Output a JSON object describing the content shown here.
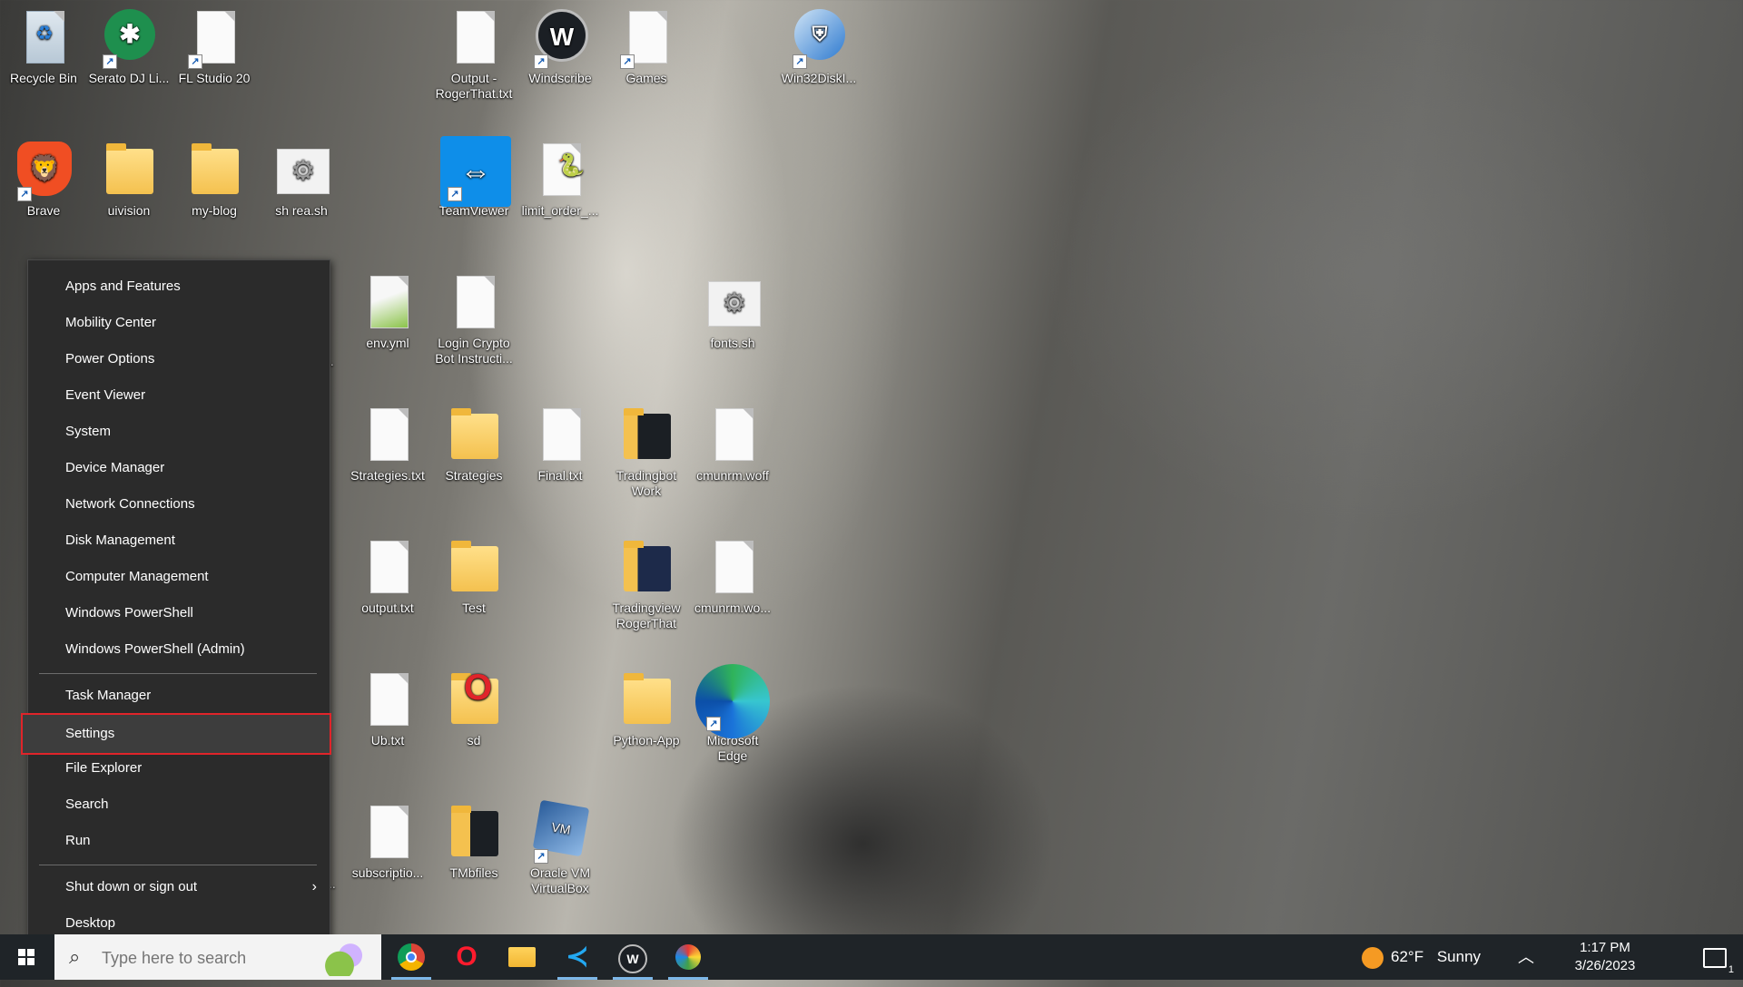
{
  "desktop": {
    "icons": [
      {
        "label": "Recycle Bin",
        "icon": "recycle-bin-icon"
      },
      {
        "label": "Serato DJ Li...",
        "icon": "serato-icon"
      },
      {
        "label": "FL Studio 20",
        "icon": "fl-studio-icon"
      },
      {
        "label": "Output - RogerThat.txt",
        "icon": "text-file-icon"
      },
      {
        "label": "Windscribe",
        "icon": "windscribe-icon"
      },
      {
        "label": "Games",
        "icon": "file-icon"
      },
      {
        "label": "Win32DiskI...",
        "icon": "win32-disk-imager-icon"
      },
      {
        "label": "Brave",
        "icon": "brave-icon"
      },
      {
        "label": "uivision",
        "icon": "folder-icon"
      },
      {
        "label": "my-blog",
        "icon": "folder-icon"
      },
      {
        "label": "sh rea.sh",
        "icon": "script-file-icon"
      },
      {
        "label": "TeamViewer",
        "icon": "teamviewer-icon"
      },
      {
        "label": "limit_order_...",
        "icon": "python-file-icon"
      },
      {
        "label": "env.yml",
        "icon": "yml-file-icon"
      },
      {
        "label": "Login Crypto Bot Instructi...",
        "icon": "text-file-icon"
      },
      {
        "label": "fonts.sh",
        "icon": "script-file-icon"
      },
      {
        "label": "Strategies.txt",
        "icon": "text-file-icon"
      },
      {
        "label": "Strategies",
        "icon": "folder-icon"
      },
      {
        "label": "Final.txt",
        "icon": "text-file-icon"
      },
      {
        "label": "Tradingbot Work",
        "icon": "folder-icon"
      },
      {
        "label": "cmunrm.woff",
        "icon": "file-icon"
      },
      {
        "label": "output.txt",
        "icon": "text-file-icon"
      },
      {
        "label": "Test",
        "icon": "folder-icon"
      },
      {
        "label": "Tradingview RogerThat",
        "icon": "folder-icon"
      },
      {
        "label": "cmunrm.wo...",
        "icon": "file-icon"
      },
      {
        "label": "Ub.txt",
        "icon": "text-file-icon"
      },
      {
        "label": "sd",
        "icon": "opera-folder-icon"
      },
      {
        "label": "Python-App",
        "icon": "folder-icon"
      },
      {
        "label": "Microsoft Edge",
        "icon": "edge-icon"
      },
      {
        "label": "subscriptio...",
        "icon": "text-file-icon"
      },
      {
        "label": "TMbfiles",
        "icon": "folder-icon"
      },
      {
        "label": "Oracle VM VirtualBox",
        "icon": "virtualbox-icon"
      },
      {
        "label": "t...",
        "icon": "file-icon"
      },
      {
        "label": "n...",
        "icon": "file-icon"
      }
    ]
  },
  "context_menu": {
    "group1": [
      "Apps and Features",
      "Mobility Center",
      "Power Options",
      "Event Viewer",
      "System",
      "Device Manager",
      "Network Connections",
      "Disk Management",
      "Computer Management",
      "Windows PowerShell",
      "Windows PowerShell (Admin)"
    ],
    "group2": [
      "Task Manager",
      "Settings",
      "File Explorer",
      "Search",
      "Run"
    ],
    "group3": [
      "Shut down or sign out",
      "Desktop"
    ],
    "highlighted": "Settings",
    "highlight_color": "#e0242a"
  },
  "taskbar": {
    "search_placeholder": "Type here to search",
    "apps": [
      "chrome-icon",
      "opera-icon",
      "file-explorer-icon",
      "vscode-icon",
      "windscribe-icon",
      "paint-icon"
    ],
    "weather": {
      "temp": "62°F",
      "condition": "Sunny"
    },
    "time": "1:17 PM",
    "date": "3/26/2023",
    "notification_count": "1"
  }
}
